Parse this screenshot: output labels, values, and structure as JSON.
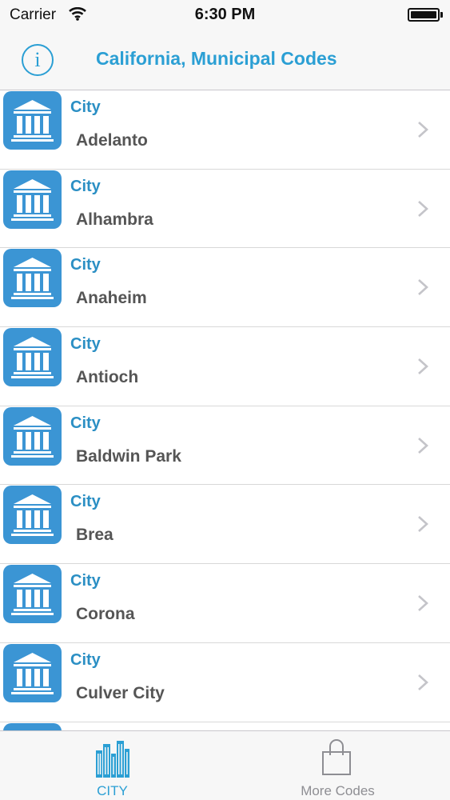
{
  "status_bar": {
    "carrier": "Carrier",
    "time": "6:30 PM"
  },
  "nav": {
    "info_symbol": "i",
    "title": "California, Municipal Codes"
  },
  "rows": [
    {
      "category": "City",
      "name": "Adelanto"
    },
    {
      "category": "City",
      "name": "Alhambra"
    },
    {
      "category": "City",
      "name": "Anaheim"
    },
    {
      "category": "City",
      "name": "Antioch"
    },
    {
      "category": "City",
      "name": "Baldwin Park"
    },
    {
      "category": "City",
      "name": "Brea"
    },
    {
      "category": "City",
      "name": "Corona"
    },
    {
      "category": "City",
      "name": "Culver City"
    },
    {
      "category": "",
      "name": ""
    }
  ],
  "tabs": [
    {
      "label": "CITY",
      "icon": "city-buildings-icon",
      "selected": true
    },
    {
      "label": "More Codes",
      "icon": "shopping-bag-icon",
      "selected": false
    }
  ],
  "colors": {
    "accent": "#2b9fd4",
    "icon_bg": "#3b95d4",
    "tab_inactive": "#8e8e93"
  }
}
